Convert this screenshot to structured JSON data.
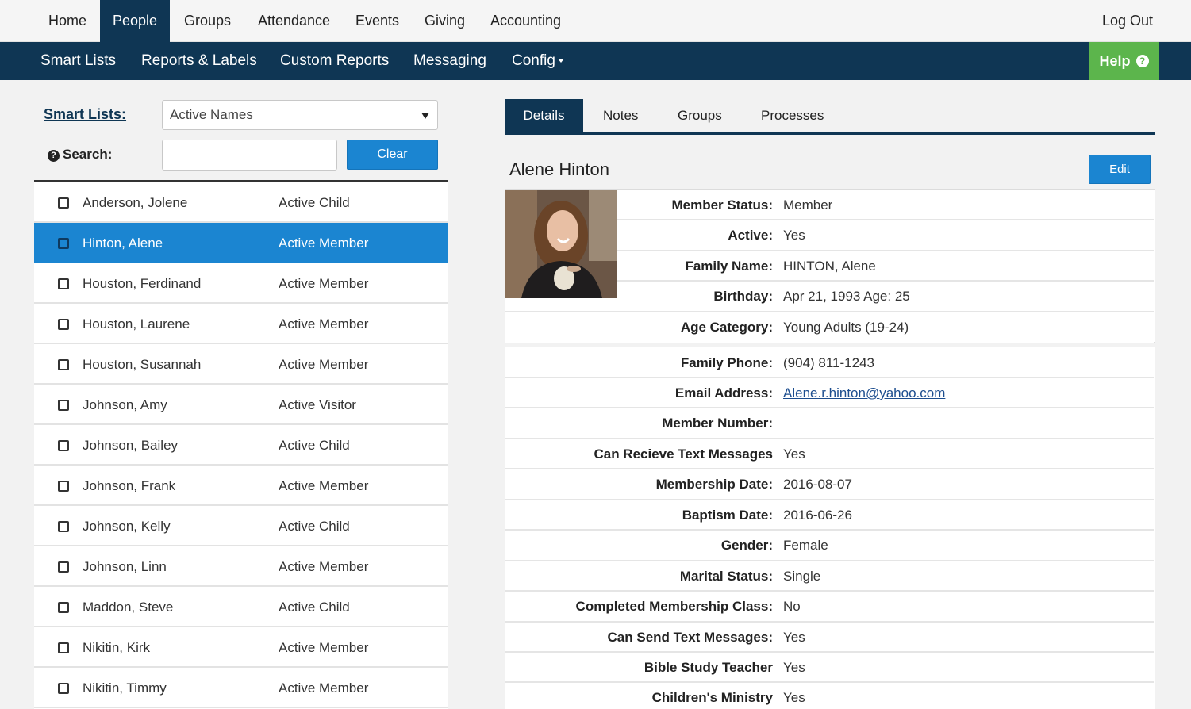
{
  "top_nav": {
    "items": [
      "Home",
      "People",
      "Groups",
      "Attendance",
      "Events",
      "Giving",
      "Accounting"
    ],
    "active": "People",
    "logout": "Log Out"
  },
  "sub_nav": {
    "items": [
      "Smart Lists",
      "Reports & Labels",
      "Custom Reports",
      "Messaging",
      "Config"
    ],
    "help": "Help"
  },
  "left": {
    "smart_lists_label": "Smart Lists:",
    "smart_list_value": "Active Names",
    "search_label": "Search:",
    "search_value": "",
    "clear_label": "Clear",
    "people": [
      {
        "name": "Anderson, Jolene",
        "status": "Active Child"
      },
      {
        "name": "Hinton, Alene",
        "status": "Active Member",
        "selected": true
      },
      {
        "name": "Houston, Ferdinand",
        "status": "Active Member"
      },
      {
        "name": "Houston, Laurene",
        "status": "Active Member"
      },
      {
        "name": "Houston, Susannah",
        "status": "Active Member"
      },
      {
        "name": "Johnson, Amy",
        "status": "Active Visitor"
      },
      {
        "name": "Johnson, Bailey",
        "status": "Active Child"
      },
      {
        "name": "Johnson, Frank",
        "status": "Active Member"
      },
      {
        "name": "Johnson, Kelly",
        "status": "Active Child"
      },
      {
        "name": "Johnson, Linn",
        "status": "Active Member"
      },
      {
        "name": "Maddon, Steve",
        "status": "Active Child"
      },
      {
        "name": "Nikitin, Kirk",
        "status": "Active Member"
      },
      {
        "name": "Nikitin, Timmy",
        "status": "Active Member"
      }
    ]
  },
  "detail": {
    "tabs": [
      "Details",
      "Notes",
      "Groups",
      "Processes"
    ],
    "active_tab": "Details",
    "person_name": "Alene Hinton",
    "edit_label": "Edit",
    "fields_top": [
      {
        "label": "Member Status:",
        "value": "Member"
      },
      {
        "label": "Active:",
        "value": "Yes"
      },
      {
        "label": "Family Name:",
        "value": "HINTON, Alene"
      },
      {
        "label": "Birthday:",
        "value": "Apr 21, 1993 Age: 25"
      },
      {
        "label": "Age Category:",
        "value": "Young Adults (19-24)"
      }
    ],
    "fields_bottom": [
      {
        "label": "Family Phone:",
        "value": "(904) 811-1243"
      },
      {
        "label": "Email Address:",
        "value": "Alene.r.hinton@yahoo.com",
        "link": true
      },
      {
        "label": "Member Number:",
        "value": ""
      },
      {
        "label": "Can Recieve Text Messages",
        "value": "Yes"
      },
      {
        "label": "Membership Date:",
        "value": "2016-08-07"
      },
      {
        "label": "Baptism Date:",
        "value": "2016-06-26"
      },
      {
        "label": "Gender:",
        "value": "Female"
      },
      {
        "label": "Marital Status:",
        "value": "Single"
      },
      {
        "label": "Completed Membership Class:",
        "value": "No"
      },
      {
        "label": "Can Send Text Messages:",
        "value": "Yes"
      },
      {
        "label": "Bible Study Teacher",
        "value": "Yes"
      },
      {
        "label": "Children's Ministry",
        "value": "Yes"
      }
    ]
  },
  "colors": {
    "navy": "#0f3654",
    "blue": "#1b85d1",
    "green": "#5cb54c"
  }
}
